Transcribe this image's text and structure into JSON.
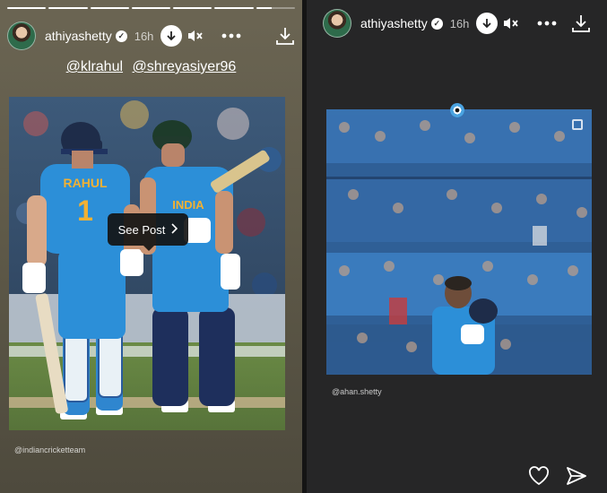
{
  "left_story": {
    "progress": [
      1,
      1,
      1,
      1,
      1,
      1,
      0.4
    ],
    "username": "athiyashetty",
    "time": "16h",
    "mentions": [
      "@klrahul",
      "@shreyasiyer96"
    ],
    "see_post_label": "See Post",
    "credit": "@indiancricketteam",
    "jersey_name": "RAHUL",
    "jersey_number": "1",
    "shirt_text": "INDIA"
  },
  "right_story": {
    "username": "athiyashetty",
    "time": "16h",
    "credit": "@ahan.shetty"
  },
  "icons": {
    "verified": "verified-badge",
    "pause": "arrow-down-circle-icon",
    "mute": "speaker-muted-icon",
    "more": "more-horizontal-icon",
    "download": "download-icon",
    "heart": "heart-icon",
    "send": "send-icon"
  },
  "colors": {
    "jersey_blue": "#2c8fd8",
    "pad_navy": "#1e2f5c",
    "crowd_blue": "#3c7fc2"
  }
}
